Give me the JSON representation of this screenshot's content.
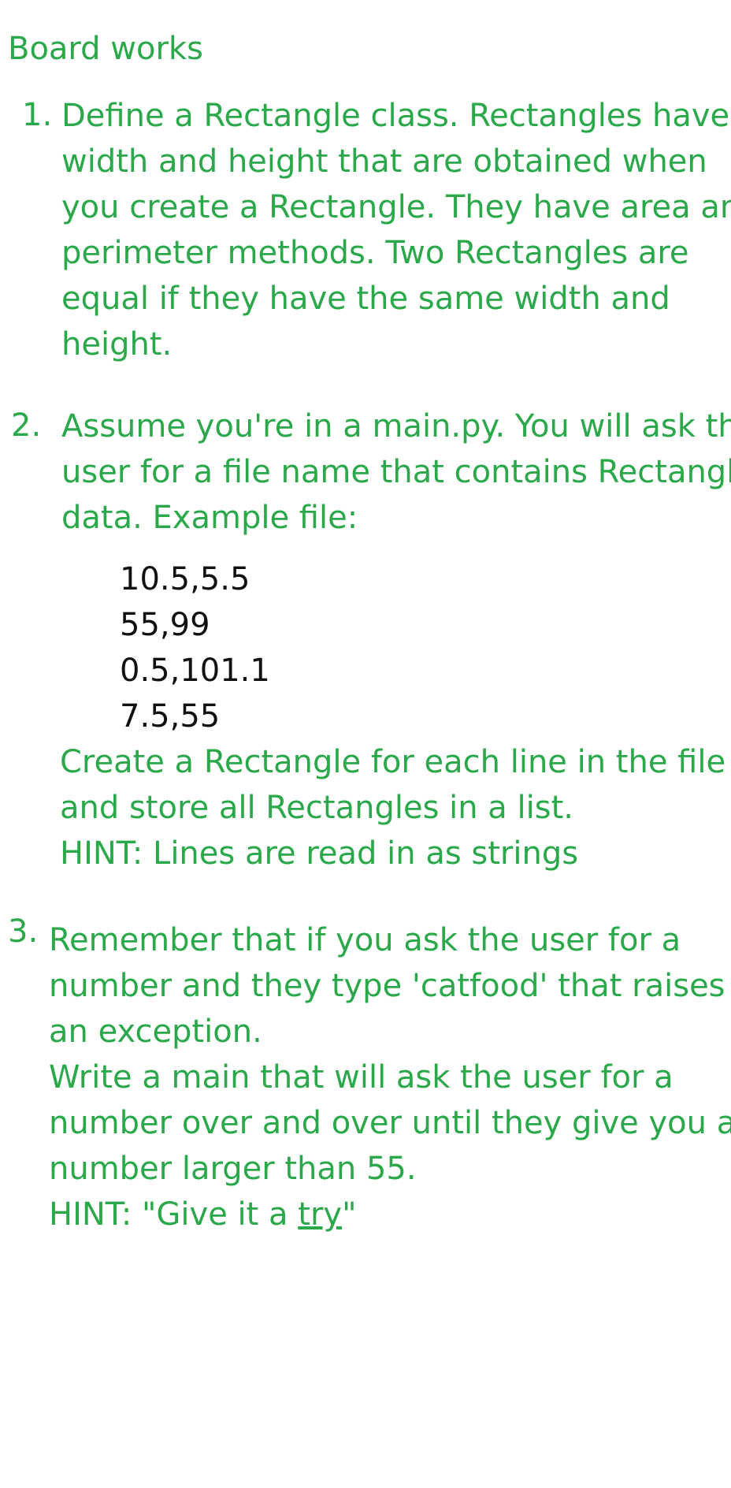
{
  "title": "Board works",
  "items": [
    {
      "number": "1.",
      "lines": [
        "Define a Rectangle class. Rectangles have a",
        "width and height that are obtained when",
        "you create a Rectangle. They have area and",
        "perimeter methods. Two Rectangles are",
        "equal if they have the same width and",
        "height."
      ]
    },
    {
      "number": "2.",
      "lines": [
        "Assume you're in a main.py. You will ask the",
        "user for a file name that contains Rectangle",
        "data.  Example file:"
      ],
      "example_file": [
        "10.5,5.5",
        "55,99",
        "0.5,101.1",
        "7.5,55"
      ],
      "after_lines": [
        "Create a Rectangle for each line in the file",
        "and store all Rectangles in a list.",
        "HINT: Lines are read in as strings"
      ]
    },
    {
      "number": "3.",
      "lines": [
        "Remember that if you ask the user for a",
        "number and they type 'catfood' that raises",
        "an exception.",
        "Write a main that will ask the user for a",
        "number over and over until they give you a",
        "number larger than 55."
      ],
      "hint_prefix": "HINT: \"Give it a ",
      "hint_link": "try",
      "hint_suffix": "\""
    }
  ]
}
